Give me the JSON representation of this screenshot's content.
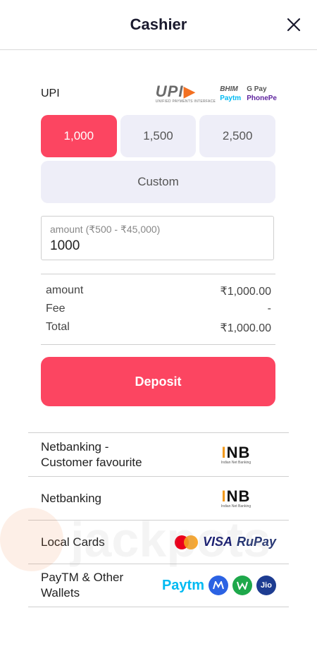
{
  "header": {
    "title": "Cashier"
  },
  "upi": {
    "label": "UPI",
    "logos": {
      "upi_main": "UPI",
      "upi_caption": "UNIFIED PAYMENTS INTERFACE",
      "bhim": "BHIM",
      "gpay": "G Pay",
      "paytm": "Paytm",
      "phonepe": "PhonePe"
    }
  },
  "amount_options": [
    "1,000",
    "1,500",
    "2,500"
  ],
  "custom_label": "Custom",
  "amount_field": {
    "placeholder": "amount (₹500 - ₹45,000)",
    "value": "1000"
  },
  "summary": {
    "amount_label": "amount",
    "amount_value": "₹1,000.00",
    "fee_label": "Fee",
    "fee_value": "-",
    "total_label": "Total",
    "total_value": "₹1,000.00"
  },
  "deposit_label": "Deposit",
  "methods": [
    {
      "name": "Netbanking - Customer favourite",
      "logo": "INB",
      "logo_caption": "Indian Net Banking"
    },
    {
      "name": "Netbanking",
      "logo": "INB",
      "logo_caption": "Indian Net Banking"
    },
    {
      "name": "Local Cards",
      "logos": [
        "VISA",
        "RuPay"
      ]
    },
    {
      "name": "PayTM & Other Wallets",
      "logos": [
        "Paytm",
        "Jio"
      ]
    }
  ],
  "watermark": {
    "text": "jackpots"
  },
  "colors": {
    "accent": "#fc4561",
    "button_bg": "#eeeef8"
  }
}
